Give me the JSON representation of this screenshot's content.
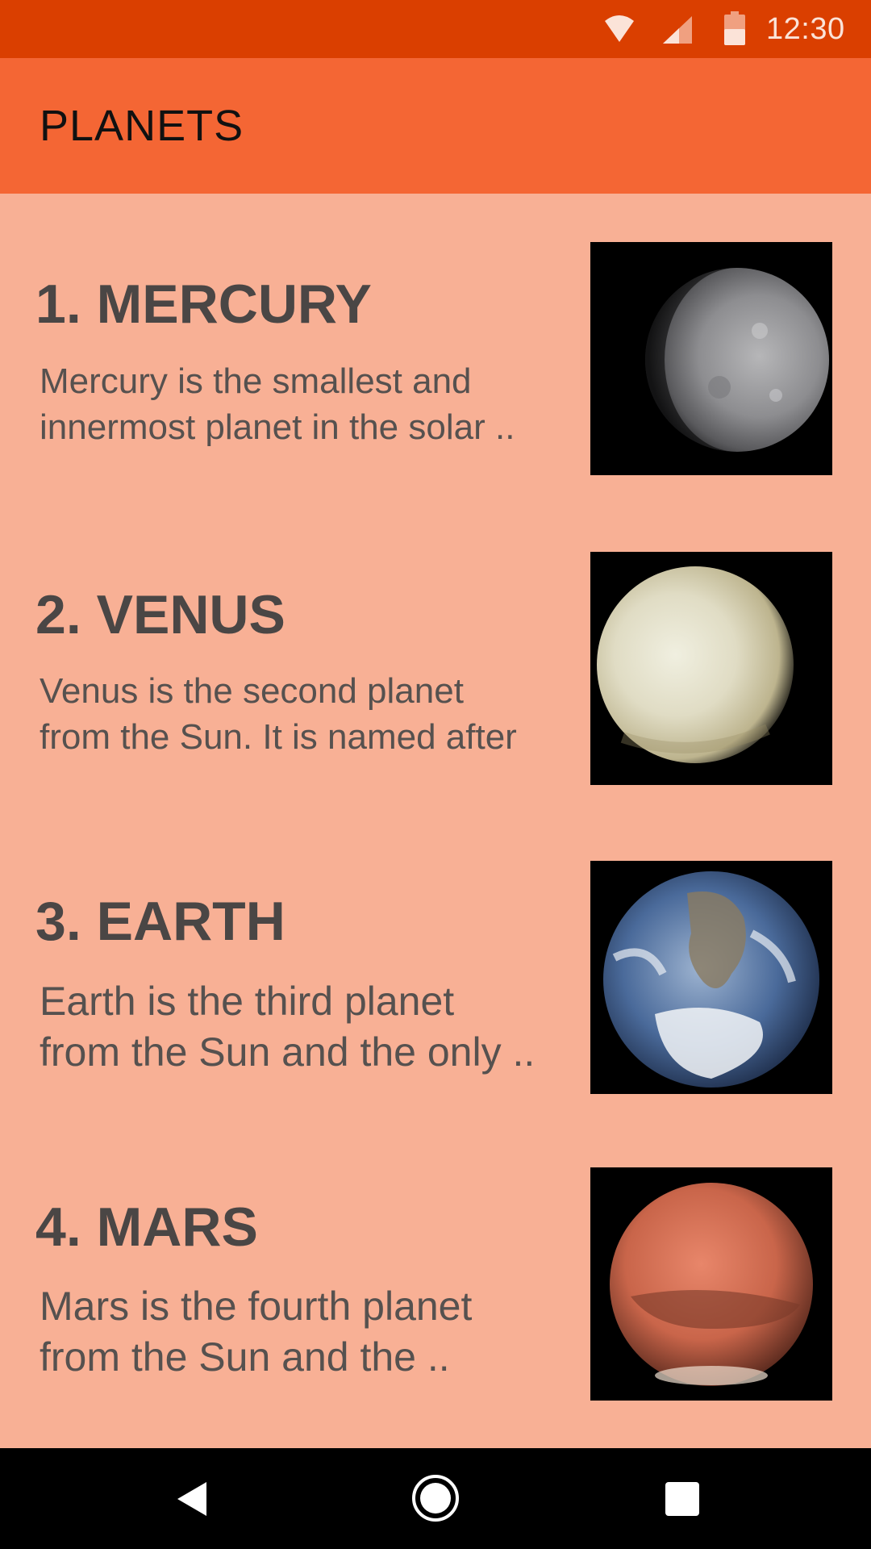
{
  "status_bar": {
    "time": "12:30",
    "icons": [
      "wifi-icon",
      "cellular-signal-icon",
      "battery-icon"
    ]
  },
  "app_bar": {
    "title": "PLANETS"
  },
  "planets": [
    {
      "name": "1. MERCURY",
      "desc_line1": "Mercury is the smallest and",
      "desc_line2": "innermost planet in the solar ..",
      "image": "mercury-image"
    },
    {
      "name": "2. VENUS",
      "desc_line1": "Venus is the second planet",
      "desc_line2": "from the Sun. It is named after",
      "image": "venus-image"
    },
    {
      "name": "3. EARTH",
      "desc_line1": "Earth is the third planet",
      "desc_line2": "from the Sun and the only ..",
      "image": "earth-image"
    },
    {
      "name": "4. MARS",
      "desc_line1": "Mars is the fourth planet",
      "desc_line2": "from the Sun and the ..",
      "image": "mars-image"
    }
  ],
  "nav_bar": {
    "icons": [
      "back-icon",
      "home-icon",
      "recents-icon"
    ]
  },
  "colors": {
    "status_bar": "#da3f00",
    "app_bar": "#f46634",
    "background": "#f8b095",
    "title_text": "#4a4645"
  }
}
